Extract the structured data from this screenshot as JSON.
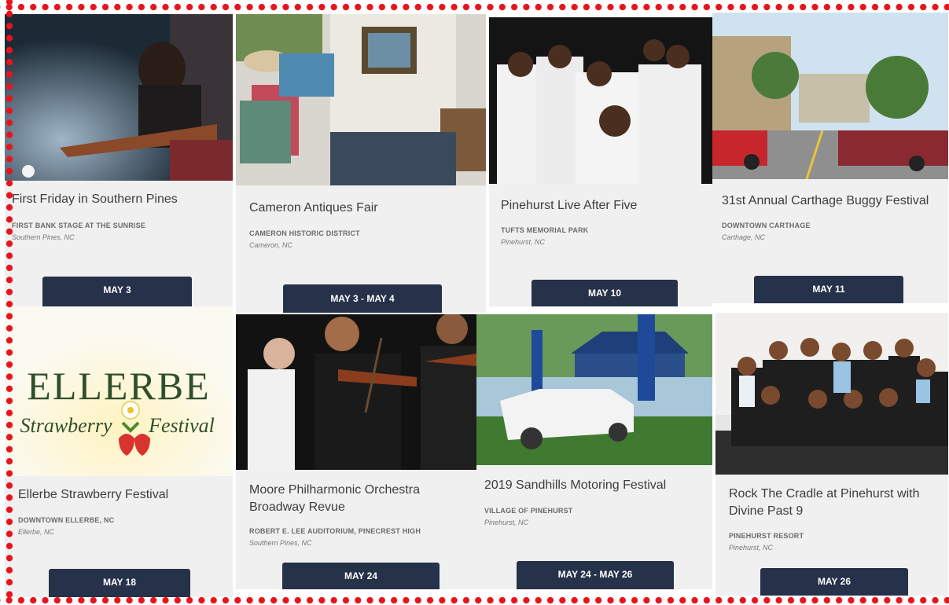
{
  "events": [
    {
      "title": "First Friday in Southern Pines",
      "venue": "FIRST BANK STAGE AT THE SUNRISE",
      "city": "Southern Pines, NC",
      "date": "MAY 3",
      "image": "guitarist-on-stage"
    },
    {
      "title": "Cameron Antiques Fair",
      "venue": "CAMERON HISTORIC DISTRICT",
      "city": "Cameron, NC",
      "date": "MAY 3 - MAY 4",
      "image": "antiques-fair"
    },
    {
      "title": "Pinehurst Live After Five",
      "venue": "TUFTS MEMORIAL PARK",
      "city": "Pinehurst, NC",
      "date": "MAY 10",
      "image": "band-in-white-suits"
    },
    {
      "title": "31st Annual Carthage Buggy Festival",
      "venue": "DOWNTOWN CARTHAGE",
      "city": "Carthage, NC",
      "date": "MAY 11",
      "image": "classic-cars-street"
    },
    {
      "title": "Ellerbe Strawberry Festival",
      "venue": "DOWNTOWN ELLERBE, NC",
      "city": "Ellerbe, NC",
      "date": "MAY 18",
      "image": "ellerbe-logo"
    },
    {
      "title": "Moore Philharmonic Orchestra Broadway Revue",
      "venue": "ROBERT E. LEE AUDITORIUM, PINECREST HIGH",
      "city": "Southern Pines, NC",
      "date": "MAY 24",
      "image": "violinists"
    },
    {
      "title": "2019 Sandhills Motoring Festival",
      "venue": "VILLAGE OF PINEHURST",
      "city": "Pinehurst, NC",
      "date": "MAY 24 - MAY 26",
      "image": "white-sports-car"
    },
    {
      "title": "Rock The Cradle at Pinehurst with Divine Past 9",
      "venue": "PINEHURST RESORT",
      "city": "Pinehurst, NC",
      "date": "MAY 26",
      "image": "band-group-photo"
    }
  ],
  "logo": {
    "line1": "ELLERBE",
    "line2a": "Strawberry",
    "line2b": "Festival"
  },
  "colors": {
    "button": "#26314a",
    "card": "#f0f0f0",
    "dots": "#e8141c"
  }
}
